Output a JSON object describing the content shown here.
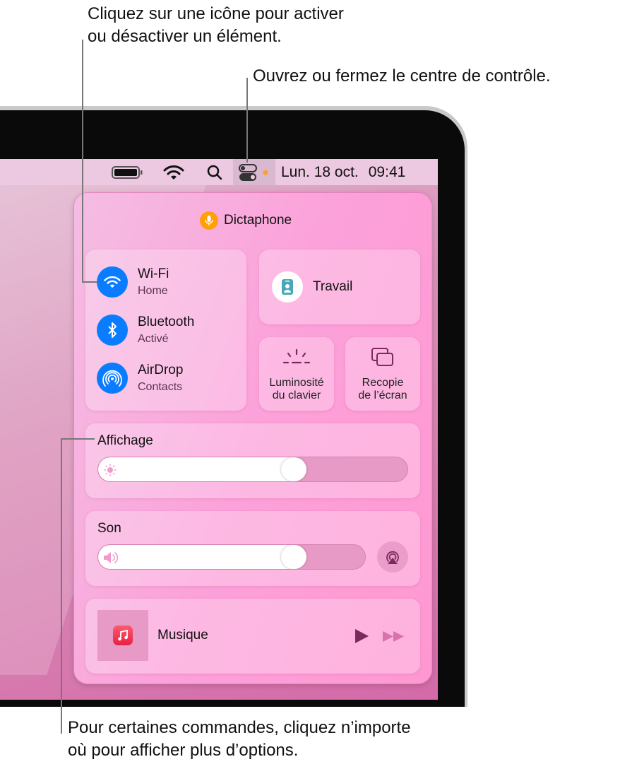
{
  "callouts": {
    "top_line1": "Cliquez sur une icône pour activer",
    "top_line2": "ou désactiver un élément.",
    "control_center": "Ouvrez ou fermez le centre de contrôle.",
    "bottom_line1": "Pour certaines commandes, cliquez n’importe",
    "bottom_line2": "où pour afficher plus d’options."
  },
  "menubar": {
    "icons": [
      "battery-icon",
      "wifi-icon",
      "search-icon",
      "control-center-icon"
    ],
    "date": "Lun. 18 oct.",
    "time": "09:41",
    "indicator_color": "#ff9f2e"
  },
  "panel": {
    "mic_app": "Dictaphone",
    "network": [
      {
        "label": "Wi-Fi",
        "status": "Home",
        "icon": "wifi-icon"
      },
      {
        "label": "Bluetooth",
        "status": "Activé",
        "icon": "bluetooth-icon"
      },
      {
        "label": "AirDrop",
        "status": "Contacts",
        "icon": "airdrop-icon"
      }
    ],
    "focus": {
      "label": "Travail",
      "icon": "id-badge-icon"
    },
    "keyboard_brightness": {
      "line1": "Luminosité",
      "line2": "du clavier"
    },
    "screen_mirroring": {
      "line1": "Recopie",
      "line2": "de l’écran"
    },
    "display": {
      "label": "Affichage",
      "brightness_percent": 63
    },
    "sound": {
      "label": "Son",
      "volume_percent": 73
    },
    "now_playing": {
      "label": "Musique"
    },
    "accent_color": "#0a7cff"
  }
}
